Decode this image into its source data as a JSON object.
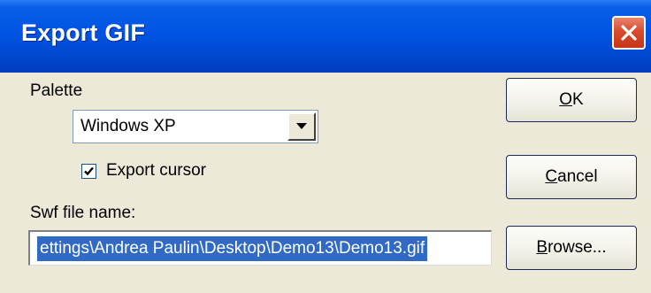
{
  "window": {
    "title": "Export GIF"
  },
  "palette": {
    "label": "Palette",
    "selected": "Windows XP"
  },
  "export_cursor": {
    "label": "Export cursor",
    "checked": true
  },
  "swf": {
    "label": "Swf file name:",
    "value": "ettings\\Andrea Paulin\\Desktop\\Demo13\\Demo13.gif"
  },
  "buttons": {
    "ok": {
      "mnemonic": "O",
      "rest": "K"
    },
    "cancel": {
      "mnemonic": "C",
      "rest": "ancel"
    },
    "browse": {
      "mnemonic": "B",
      "rest": "rowse..."
    }
  },
  "icons": {
    "close": "close-icon",
    "dropdown": "chevron-down-icon",
    "check": "checkmark-icon"
  },
  "colors": {
    "titlebar": "#0054e3",
    "dialog_bg": "#ece9d8",
    "close_button": "#d9492b",
    "selection": "#316ac5"
  }
}
